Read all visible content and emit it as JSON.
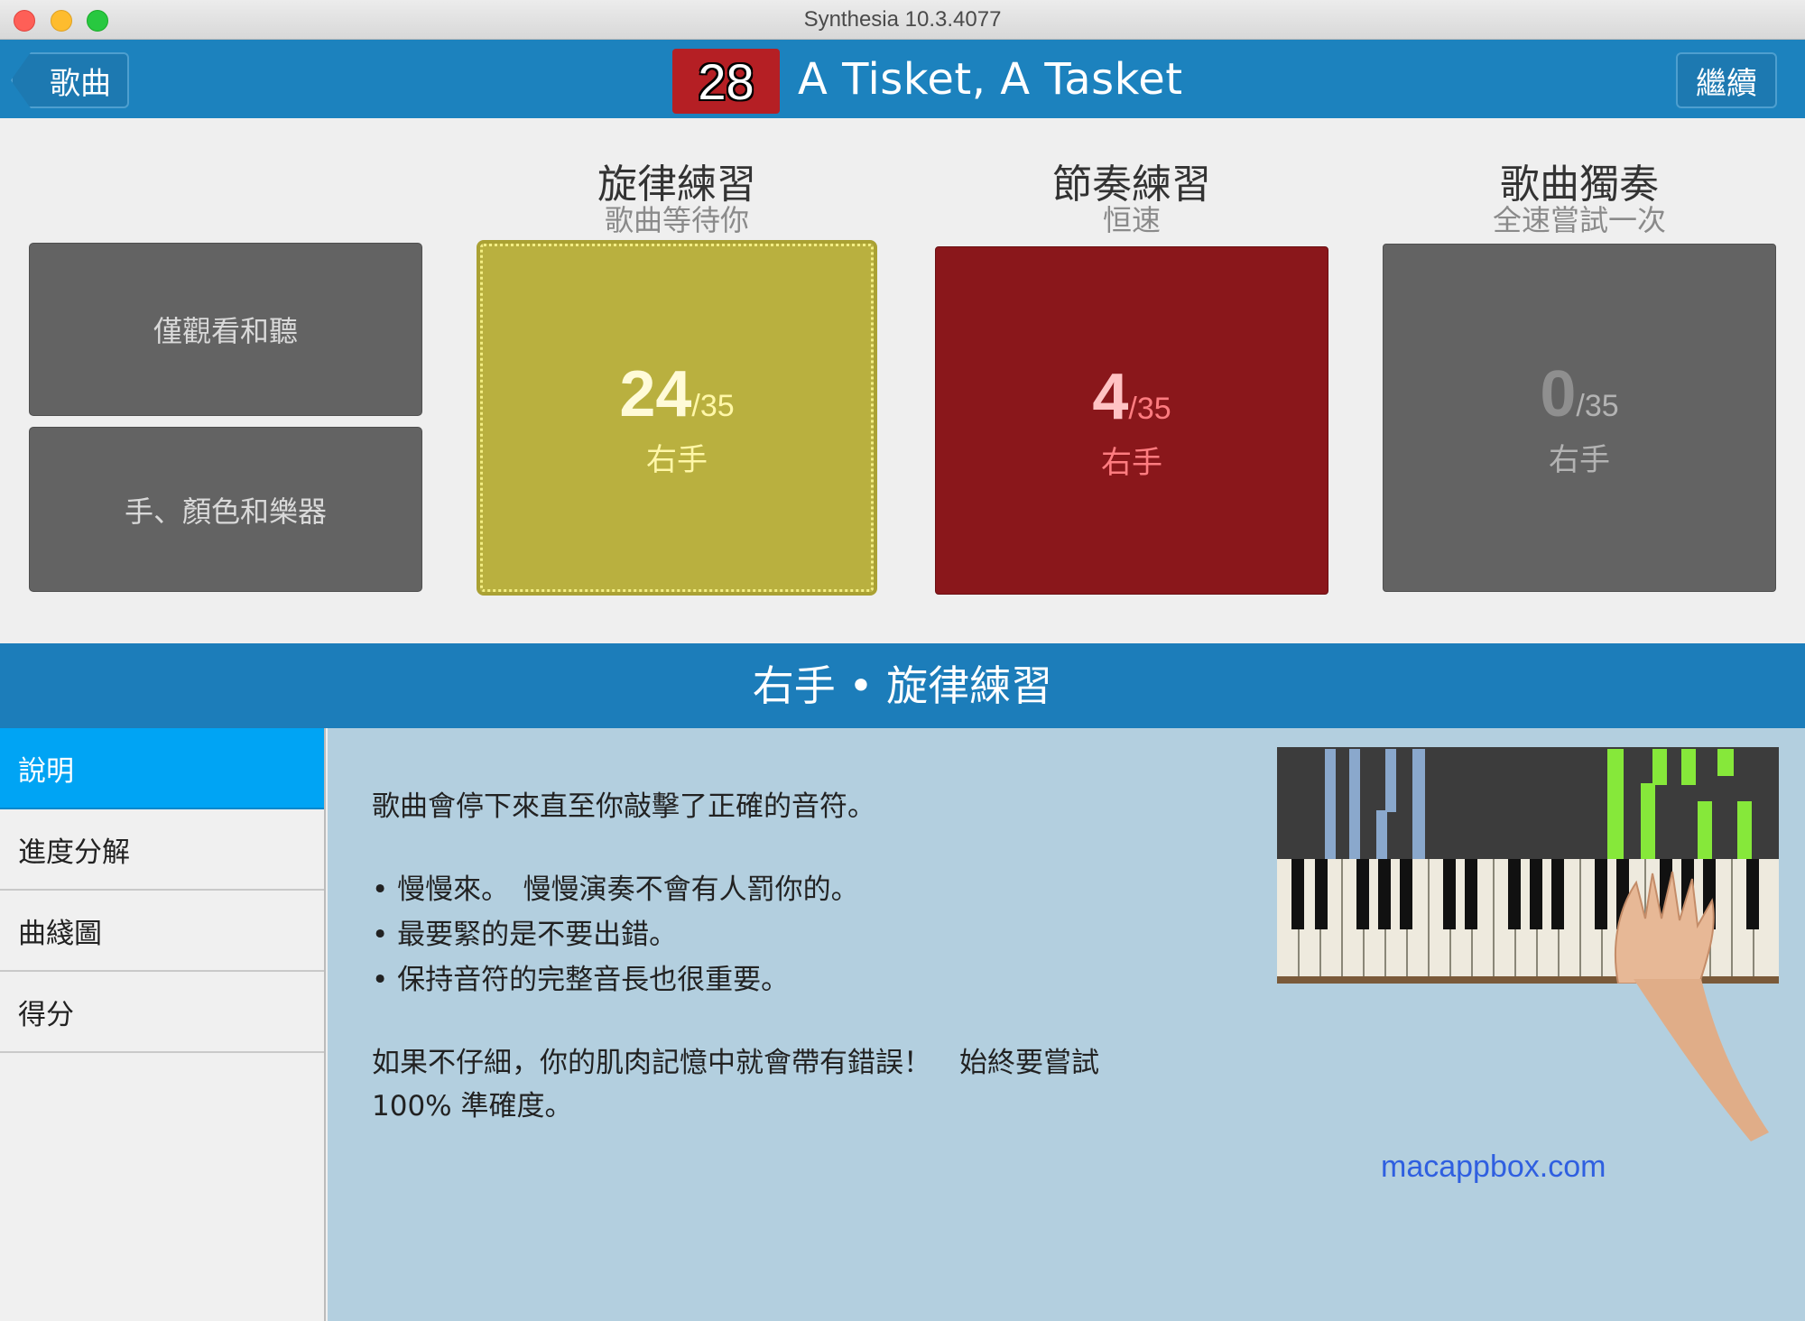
{
  "window": {
    "title": "Synthesia 10.3.4077"
  },
  "header": {
    "back_label": "歌曲",
    "level": "28",
    "song_title": "A Tisket, A Tasket",
    "continue_label": "繼續"
  },
  "left_buttons": {
    "watch": "僅觀看和聽",
    "hands": "手、顏色和樂器"
  },
  "modes": [
    {
      "title": "旋律練習",
      "subtitle": "歌曲等待你",
      "score": "24",
      "total": "/35",
      "hand": "右手"
    },
    {
      "title": "節奏練習",
      "subtitle": "恒速",
      "score": "4",
      "total": "/35",
      "hand": "右手"
    },
    {
      "title": "歌曲獨奏",
      "subtitle": "全速嘗試一次",
      "score": "0",
      "total": "/35",
      "hand": "右手"
    }
  ],
  "section": {
    "title": "右手 • 旋律練習"
  },
  "sidebar": {
    "items": [
      {
        "label": "說明"
      },
      {
        "label": "進度分解"
      },
      {
        "label": "曲綫圖"
      },
      {
        "label": "得分"
      }
    ]
  },
  "content": {
    "intro": "歌曲會停下來直至你敲擊了正確的音符。",
    "bullet1": "• 慢慢來。　慢慢演奏不會有人罰你的。",
    "bullet2": "• 最要緊的是不要出錯。",
    "bullet3": "• 保持音符的完整音長也很重要。",
    "warning_line1": "如果不仔細，你的肌肉記憶中就會帶有錯誤！　始終要嘗試",
    "warning_line2": "100% 準確度。"
  },
  "watermark": "macappbox.com",
  "colors": {
    "header_blue": "#1c82be",
    "melody_card": "#b9b03f",
    "rhythm_card": "#8a171b",
    "solo_card": "#636363",
    "active_tab": "#00a4f4",
    "content_bg": "#b3cfdf"
  }
}
